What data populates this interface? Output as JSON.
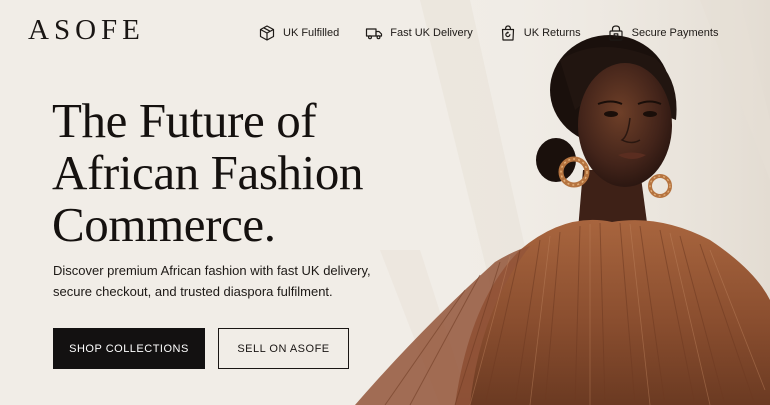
{
  "brand": {
    "name": "ASOFE"
  },
  "trust_bar": [
    {
      "label": "UK Fulfilled",
      "icon": "box-icon"
    },
    {
      "label": "Fast UK Delivery",
      "icon": "truck-icon"
    },
    {
      "label": "UK Returns",
      "icon": "return-bag-icon"
    },
    {
      "label": "Secure Payments",
      "icon": "lock-icon"
    }
  ],
  "hero": {
    "headline": [
      "The Future of",
      "African Fashion",
      "Commerce."
    ],
    "subtext": [
      "Discover premium African fashion with fast UK delivery,",
      "secure checkout, and trusted diaspora fulfilment."
    ],
    "primary_cta": "SHOP COLLECTIONS",
    "secondary_cta": "SELL ON ASOFE",
    "image": "model-in-brown-pleated-cape-photo"
  },
  "colors": {
    "background": "#f1ede7",
    "text": "#161311",
    "primary_button": "#131111",
    "garment": "#8a4e2f"
  }
}
